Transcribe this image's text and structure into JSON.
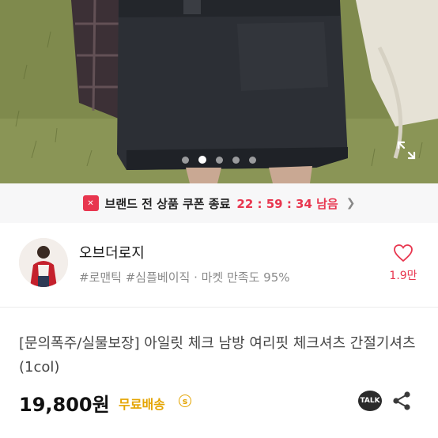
{
  "carousel": {
    "total_slides": 5,
    "active_slide": 2
  },
  "coupon": {
    "text": "브랜드 전 상품 쿠폰 종료",
    "timer": "22 : 59 : 34 남음",
    "accent_color": "#e8364f"
  },
  "shop": {
    "name": "오브더로지",
    "tags": "#로맨틱 #심플베이직 · 마켓 만족도 95%",
    "likes": "1.9만"
  },
  "product": {
    "title": "[문의폭주/실물보장] 아일릿 체크 남방 여리핏 체크셔츠 간절기셔츠 (1col)",
    "price": "19,800원",
    "shipping": "무료배송",
    "shipping_info_icon": "ⓢ",
    "talk_label": "TALK"
  },
  "icons": {
    "expand": "expand-icon",
    "coupon": "coupon-icon",
    "heart": "heart-icon",
    "talk": "kakaotalk-icon",
    "share": "share-icon"
  }
}
